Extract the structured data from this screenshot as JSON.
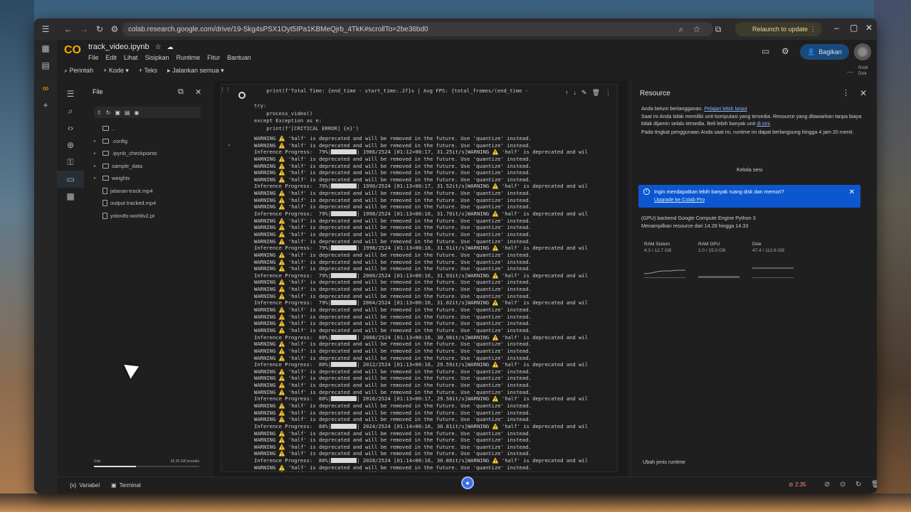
{
  "browser": {
    "url": "colab.research.google.com/drive/19-Skg4sPSX1Oyt5IPa1KBMeQjrb_4TkK#scrollTo=2be36bd0",
    "relaunch_label": "Relaunch to update"
  },
  "header": {
    "notebook_name": "track_video.ipynb",
    "menu": [
      "File",
      "Edit",
      "Lihat",
      "Sisipkan",
      "Runtime",
      "Fitur",
      "Bantuan"
    ],
    "share_label": "Bagikan",
    "toolbar": {
      "command": "Perintah",
      "code": "+ Kode",
      "text": "+ Teks",
      "run_all": "Jalankan semua"
    },
    "ram_label": "RAM",
    "disk_label": "Disk"
  },
  "files": {
    "title": "File",
    "items": [
      {
        "name": "..",
        "type": "folder",
        "expandable": false
      },
      {
        "name": ".config",
        "type": "folder",
        "expandable": true
      },
      {
        "name": ".ipynb_checkpoints",
        "type": "folder",
        "expandable": true
      },
      {
        "name": "sample_data",
        "type": "folder",
        "expandable": true
      },
      {
        "name": "weights",
        "type": "folder",
        "expandable": true
      },
      {
        "name": "jalanan-track.mp4",
        "type": "file",
        "expandable": false
      },
      {
        "name": "output tracked.mp4",
        "type": "file",
        "expandable": false
      },
      {
        "name": "yolov8s-worldv2.pt",
        "type": "file",
        "expandable": false
      }
    ],
    "disk_label": "Disk",
    "disk_available": "65.28 GB tersedia",
    "disk_used_fraction": 0.4
  },
  "cell": {
    "exec_label": "[  ]",
    "code_lines": [
      "    print(f'Total Time: {end_time - start_time:.2f}s | Avg FPS: {total_frames/(end_time -",
      "",
      "try:",
      "    process_video()",
      "except Exception as e:",
      "    print(f'[CRITICAL ERROR] {e}')"
    ],
    "output_lines": [
      {
        "t": "WARNING ⚠️ 'half' is deprecated and will be removed in the future. Use 'quantize' instead."
      },
      {
        "t": "WARNING ⚠️ 'half' is deprecated and will be removed in the future. Use 'quantize' instead."
      },
      {
        "p": "Inference Progress:  79%|",
        "r": "| 1986/2524 [01:12<00:17, 31.25it/s]WARNING ⚠️ 'half' is deprecated and wil"
      },
      {
        "t": "WARNING ⚠️ 'half' is deprecated and will be removed in the future. Use 'quantize' instead."
      },
      {
        "t": "WARNING ⚠️ 'half' is deprecated and will be removed in the future. Use 'quantize' instead."
      },
      {
        "t": "WARNING ⚠️ 'half' is deprecated and will be removed in the future. Use 'quantize' instead."
      },
      {
        "t": "WARNING ⚠️ 'half' is deprecated and will be removed in the future. Use 'quantize' instead."
      },
      {
        "p": "Inference Progress:  79%|",
        "r": "| 1990/2524 [01:13<00:17, 31.52it/s]WARNING ⚠️ 'half' is deprecated and wil"
      },
      {
        "t": "WARNING ⚠️ 'half' is deprecated and will be removed in the future. Use 'quantize' instead."
      },
      {
        "t": "WARNING ⚠️ 'half' is deprecated and will be removed in the future. Use 'quantize' instead."
      },
      {
        "t": "WARNING ⚠️ 'half' is deprecated and will be removed in the future. Use 'quantize' instead."
      },
      {
        "p": "Inference Progress:  79%|",
        "r": "| 1998/2524 [01:13<00:16, 31.70it/s]WARNING ⚠️ 'half' is deprecated and wil"
      },
      {
        "t": "WARNING ⚠️ 'half' is deprecated and will be removed in the future. Use 'quantize' instead."
      },
      {
        "t": "WARNING ⚠️ 'half' is deprecated and will be removed in the future. Use 'quantize' instead."
      },
      {
        "t": "WARNING ⚠️ 'half' is deprecated and will be removed in the future. Use 'quantize' instead."
      },
      {
        "t": "WARNING ⚠️ 'half' is deprecated and will be removed in the future. Use 'quantize' instead."
      },
      {
        "p": "Inference Progress:  79%|",
        "r": "| 1998/2524 [01:13<00:16, 31.91it/s]WARNING ⚠️ 'half' is deprecated and wil"
      },
      {
        "t": "WARNING ⚠️ 'half' is deprecated and will be removed in the future. Use 'quantize' instead."
      },
      {
        "t": "WARNING ⚠️ 'half' is deprecated and will be removed in the future. Use 'quantize' instead."
      },
      {
        "t": "WARNING ⚠️ 'half' is deprecated and will be removed in the future. Use 'quantize' instead."
      },
      {
        "p": "Inference Progress:  79%|",
        "r": "| 2000/2524 [01:13<00:16, 31.93it/s]WARNING ⚠️ 'half' is deprecated and wil"
      },
      {
        "t": "WARNING ⚠️ 'half' is deprecated and will be removed in the future. Use 'quantize' instead."
      },
      {
        "t": "WARNING ⚠️ 'half' is deprecated and will be removed in the future. Use 'quantize' instead."
      },
      {
        "t": "WARNING ⚠️ 'half' is deprecated and will be removed in the future. Use 'quantize' instead."
      },
      {
        "p": "Inference Progress:  79%|",
        "r": "| 2004/2524 [01:13<00:16, 31.02it/s]WARNING ⚠️ 'half' is deprecated and wil"
      },
      {
        "t": "WARNING ⚠️ 'half' is deprecated and will be removed in the future. Use 'quantize' instead."
      },
      {
        "t": "WARNING ⚠️ 'half' is deprecated and will be removed in the future. Use 'quantize' instead."
      },
      {
        "t": "WARNING ⚠️ 'half' is deprecated and will be removed in the future. Use 'quantize' instead."
      },
      {
        "t": "WARNING ⚠️ 'half' is deprecated and will be removed in the future. Use 'quantize' instead."
      },
      {
        "p": "Inference Progress:  80%|",
        "r": "| 2008/2524 [01:13<00:16, 30.98it/s]WARNING ⚠️ 'half' is deprecated and wil"
      },
      {
        "t": "WARNING ⚠️ 'half' is deprecated and will be removed in the future. Use 'quantize' instead."
      },
      {
        "t": "WARNING ⚠️ 'half' is deprecated and will be removed in the future. Use 'quantize' instead."
      },
      {
        "t": "WARNING ⚠️ 'half' is deprecated and will be removed in the future. Use 'quantize' instead."
      },
      {
        "p": "Inference Progress:  80%|",
        "r": "| 2012/2524 [01:13<00:16, 29.59it/s]WARNING ⚠️ 'half' is deprecated and wil"
      },
      {
        "t": "WARNING ⚠️ 'half' is deprecated and will be removed in the future. Use 'quantize' instead."
      },
      {
        "t": "WARNING ⚠️ 'half' is deprecated and will be removed in the future. Use 'quantize' instead."
      },
      {
        "t": "WARNING ⚠️ 'half' is deprecated and will be removed in the future. Use 'quantize' instead."
      },
      {
        "t": "WARNING ⚠️ 'half' is deprecated and will be removed in the future. Use 'quantize' instead."
      },
      {
        "p": "Inference Progress:  80%|",
        "r": "| 2016/2524 [01:13<00:17, 29.58it/s]WARNING ⚠️ 'half' is deprecated and wil"
      },
      {
        "t": "WARNING ⚠️ 'half' is deprecated and will be removed in the future. Use 'quantize' instead."
      },
      {
        "t": "WARNING ⚠️ 'half' is deprecated and will be removed in the future. Use 'quantize' instead."
      },
      {
        "t": "WARNING ⚠️ 'half' is deprecated and will be removed in the future. Use 'quantize' instead."
      },
      {
        "p": "Inference Progress:  80%|",
        "r": "| 2024/2524 [01:14<00:16, 30.81it/s]WARNING ⚠️ 'half' is deprecated and wil"
      },
      {
        "t": "WARNING ⚠️ 'half' is deprecated and will be removed in the future. Use 'quantize' instead."
      },
      {
        "t": "WARNING ⚠️ 'half' is deprecated and will be removed in the future. Use 'quantize' instead."
      },
      {
        "t": "WARNING ⚠️ 'half' is deprecated and will be removed in the future. Use 'quantize' instead."
      },
      {
        "t": "WARNING ⚠️ 'half' is deprecated and will be removed in the future. Use 'quantize' instead."
      },
      {
        "p": "Inference Progress:  80%|",
        "r": "| 2028/2524 [01:14<00:16, 30.80it/s]WARNING ⚠️ 'half' is deprecated and wil"
      },
      {
        "t": "WARNING ⚠️ 'half' is deprecated and will be removed in the future. Use 'quantize' instead."
      },
      {
        "t": "WARNING ⚠️ 'half' is deprecated and will be removed in the future. Use 'quantize' instead."
      },
      {
        "t": "WARNING ⚠️ 'half' is deprecated and will be removed in the future. Use 'quantize' instead."
      },
      {
        "t": "WARNING ⚠️ 'half' is deprecated and will be removed in the future. Use 'quantize' instead."
      },
      {
        "p": "Inference Progress:  80%|",
        "r": "| 2037/2524 [01:14<00:16, 30.59it/s]WARNING ⚠️ 'half' is deprecated and wil"
      },
      {
        "t": "WARNING ⚠️ 'half' is deprecated and will be removed in the future. Use 'quantize' instead."
      }
    ]
  },
  "resources": {
    "title": "Resource",
    "not_subscribed": "Anda belum berlangganan.",
    "learn_more": "Pelajari lebih lanjut",
    "no_units": "Saat ini Anda tidak memiliki unit komputasi yang tersedia. Resource yang ditawarkan tanpa biaya tidak dijamin selalu tersedia. Beli lebih banyak unit",
    "here_link": "di sini",
    "usage_note": "Pada tingkat penggunaan Anda saat ini, runtime ini dapat berlangsung hingga 4 jam 20 menit.",
    "manage_sessions": "Kelola sesi",
    "alert_text": "Ingin mendapatkan lebih banyak ruang disk dan memori?",
    "alert_link": "Upgrade ke Colab Pro",
    "backend": "(GPU) backend Google Compute Engine Python 3",
    "showing": "Menampilkan resource dari 14.28 hingga 14.33",
    "meters": [
      {
        "label": "RAM Sistem",
        "value": "4.3 / 12.7 GB"
      },
      {
        "label": "RAM GPU",
        "value": "1.0 / 15.0 GB"
      },
      {
        "label": "Disk",
        "value": "47.4 / 112.6 GB"
      }
    ],
    "change_runtime": "Ubah jenis runtime"
  },
  "status": {
    "variables": "Variabel",
    "terminal": "Terminal",
    "timer": "2:35"
  }
}
